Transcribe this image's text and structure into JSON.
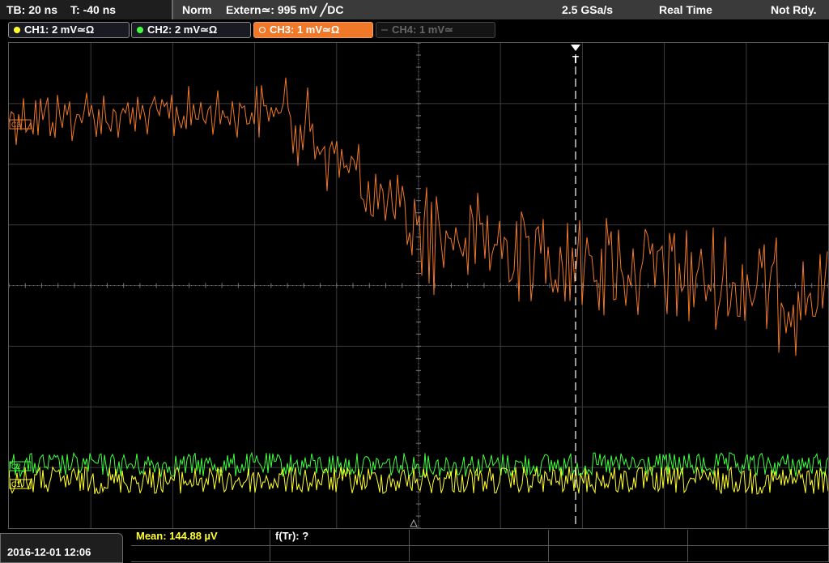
{
  "header": {
    "timebase": "TB: 20 ns",
    "trigger_offset": "T: -40 ns",
    "trigger_mode": "Norm",
    "trigger_source": "Extern≃: 995 mV ╱DC",
    "sample_rate": "2.5 GSa/s",
    "acq_mode": "Real Time",
    "status": "Not Rdy."
  },
  "channels": [
    {
      "label": "CH1: 2 mV≃Ω",
      "color": "#ffff30",
      "state": "on"
    },
    {
      "label": "CH2: 2 mV≃Ω",
      "color": "#40ff40",
      "state": "on"
    },
    {
      "label": "CH3: 1 mV≃Ω",
      "color": "#f07828",
      "state": "active"
    },
    {
      "label": "CH4: 1 mV≃",
      "color": "#666666",
      "state": "off"
    }
  ],
  "markers": {
    "trigger": "T",
    "ch3_ref": "C3",
    "ch2_ref": "C2",
    "ch1_ref": "C1"
  },
  "footer": {
    "datetime": "2016-12-01 12:06",
    "mean_label": "Mean: 144.88 µV",
    "ftr_label": "f(Tr): ?"
  },
  "colors": {
    "ch1": "#ffff30",
    "ch2": "#40ff40",
    "ch3": "#f07828",
    "grid": "#4a4a4a",
    "trigger_line": "#ffffff"
  }
}
